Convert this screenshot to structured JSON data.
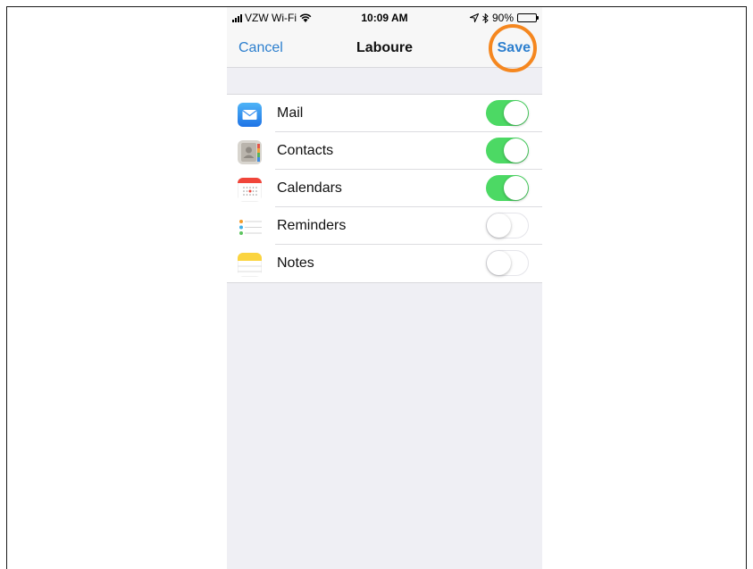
{
  "status_bar": {
    "carrier": "VZW Wi-Fi",
    "time": "10:09 AM",
    "battery": "90%",
    "battery_level": 0.9
  },
  "nav": {
    "cancel_label": "Cancel",
    "title": "Laboure",
    "save_label": "Save"
  },
  "accent_color": "#2d7fce",
  "toggle_on_color": "#4cd964",
  "highlight_color": "#f5871f",
  "items": [
    {
      "label": "Mail",
      "icon": "mail-icon",
      "enabled": true
    },
    {
      "label": "Contacts",
      "icon": "contacts-icon",
      "enabled": true
    },
    {
      "label": "Calendars",
      "icon": "calendar-icon",
      "enabled": true
    },
    {
      "label": "Reminders",
      "icon": "reminders-icon",
      "enabled": false
    },
    {
      "label": "Notes",
      "icon": "notes-icon",
      "enabled": false
    }
  ]
}
